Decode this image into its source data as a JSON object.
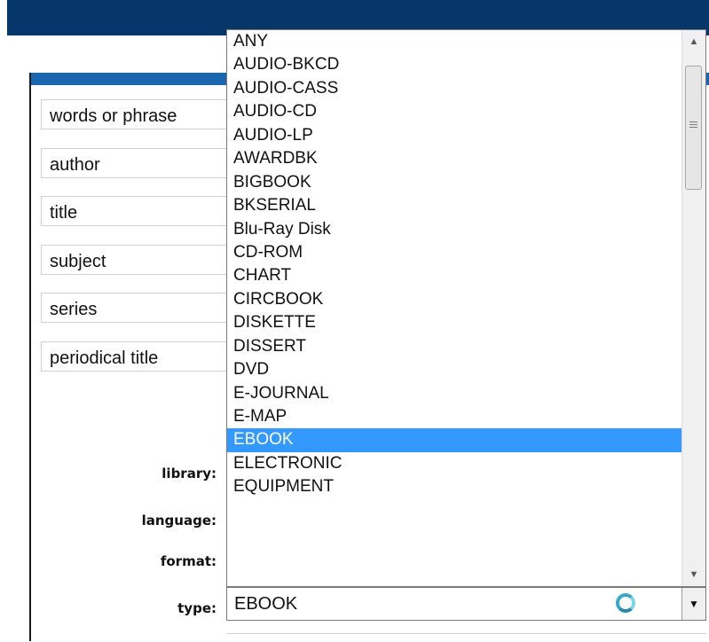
{
  "search_fields": [
    {
      "label": "words or phrase"
    },
    {
      "label": "author"
    },
    {
      "label": "title"
    },
    {
      "label": "subject"
    },
    {
      "label": "series"
    },
    {
      "label": "periodical title"
    }
  ],
  "filters": {
    "library_label": "library:",
    "language_label": "language:",
    "format_label": "format:",
    "type_label": "type:"
  },
  "type_select": {
    "selected_value": "EBOOK",
    "options": [
      "ANY",
      "AUDIO-BKCD",
      "AUDIO-CASS",
      "AUDIO-CD",
      "AUDIO-LP",
      "AWARDBK",
      "BIGBOOK",
      "BKSERIAL",
      "Blu-Ray Disk",
      "CD-ROM",
      "CHART",
      "CIRCBOOK",
      "DISKETTE",
      "DISSERT",
      "DVD",
      "E-JOURNAL",
      "E-MAP",
      "EBOOK",
      "ELECTRONIC",
      "EQUIPMENT"
    ],
    "highlighted_index": 17
  },
  "icons": {
    "scroll_up": "chevron-up-icon",
    "scroll_down": "chevron-down-icon",
    "dropdown": "chevron-down-icon",
    "loading": "loading-spinner-icon"
  },
  "colors": {
    "header": "#07376a",
    "panel_accent": "#1a67b0",
    "selection": "#3399ff"
  }
}
